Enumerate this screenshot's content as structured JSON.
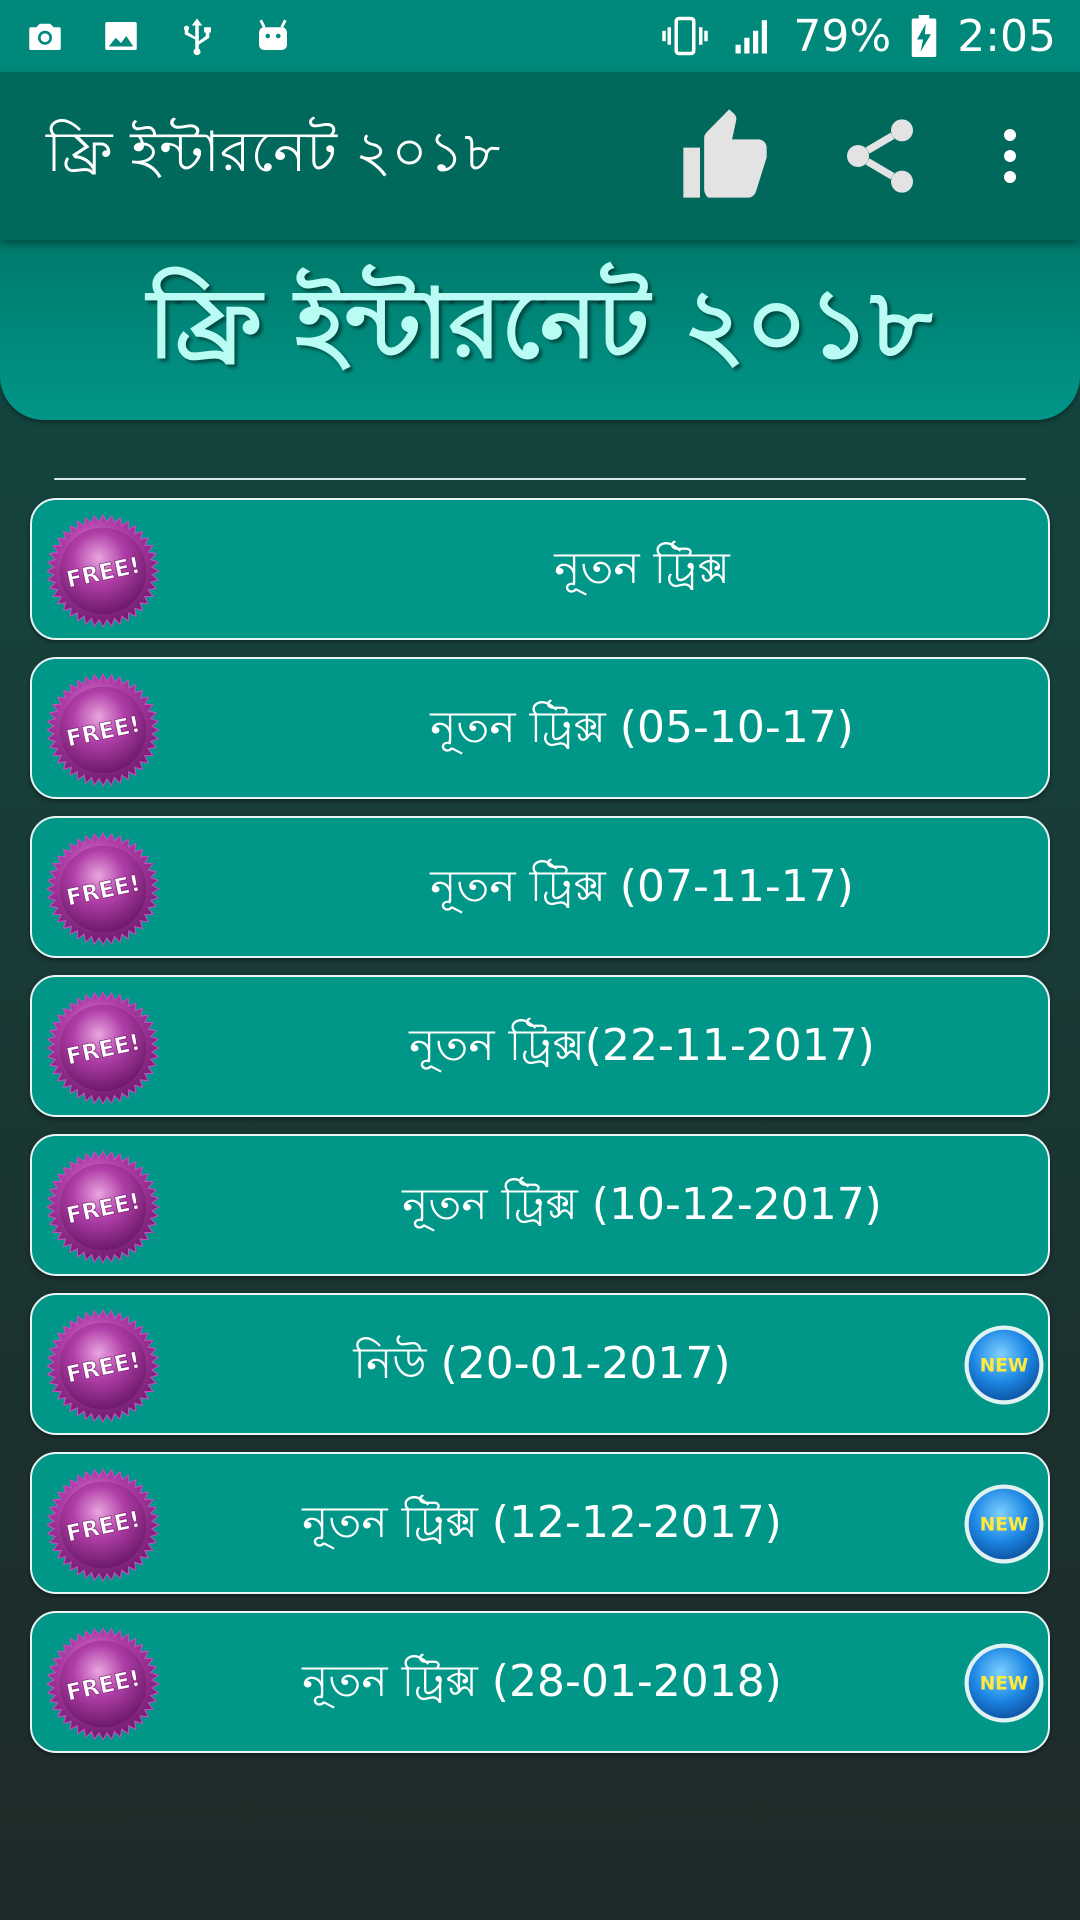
{
  "status_bar": {
    "battery": "79%",
    "time": "2:05",
    "left_icons": [
      "camera-icon",
      "image-icon",
      "usb-icon",
      "android-icon"
    ],
    "right_icons": [
      "vibrate-icon",
      "signal-icon",
      "battery-charging-icon"
    ]
  },
  "toolbar": {
    "title": "ফ্রি ইন্টারনেট ২০১৮",
    "actions": [
      "thumbs-up-icon",
      "share-icon",
      "more-vert-icon"
    ]
  },
  "banner": {
    "title": "ফ্রি ইন্টারনেট ২০১৮"
  },
  "colors": {
    "primary": "#009688",
    "primary_dark": "#00695c",
    "status_bar": "#00897b",
    "banner_text": "#b9fcf4",
    "free_badge": "#a0329a",
    "new_badge": "#1e88e5",
    "new_badge_text": "#ffeb3b"
  },
  "badges": {
    "free": "FREE!",
    "new": "NEW"
  },
  "items": [
    {
      "label": "নূতন ট্রিক্স",
      "is_new": false
    },
    {
      "label": "নূতন ট্রিক্স (05-10-17)",
      "is_new": false
    },
    {
      "label": "নূতন ট্রিক্স (07-11-17)",
      "is_new": false
    },
    {
      "label": "নূতন ট্রিক্স(22-11-2017)",
      "is_new": false
    },
    {
      "label": "নূতন ট্রিক্স (10-12-2017)",
      "is_new": false
    },
    {
      "label": "নিউ (20-01-2017)",
      "is_new": true
    },
    {
      "label": "নূতন ট্রিক্স (12-12-2017)",
      "is_new": true
    },
    {
      "label": "নূতন ট্রিক্স (28-01-2018)",
      "is_new": true
    }
  ]
}
